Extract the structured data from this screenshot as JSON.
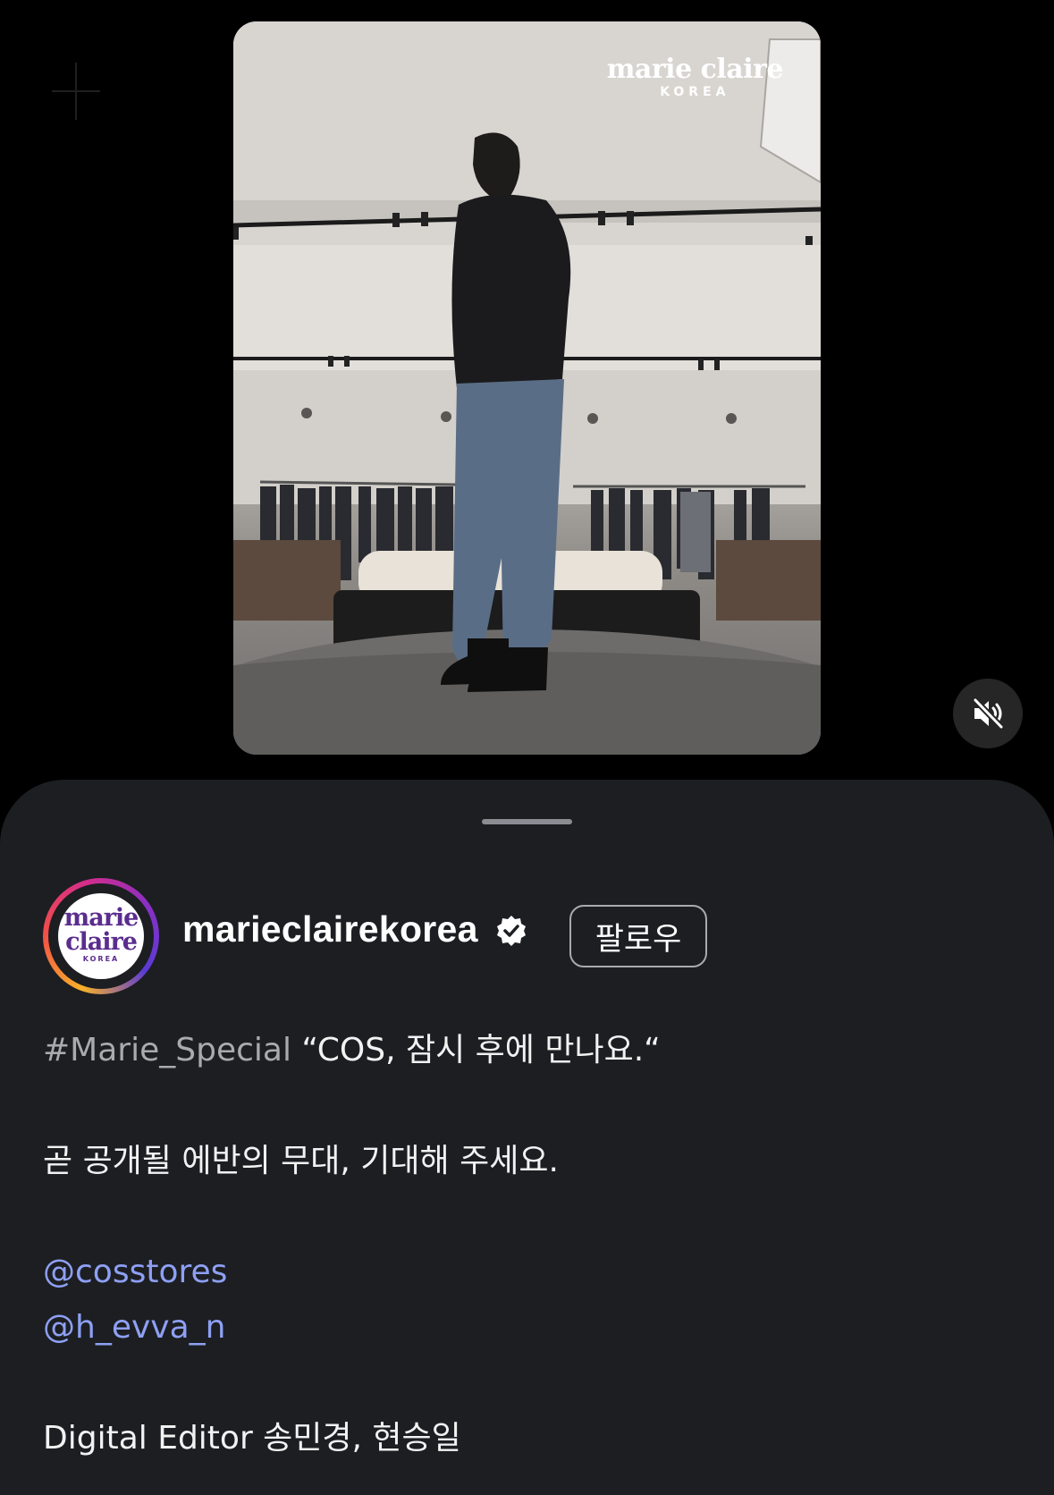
{
  "video": {
    "watermark_main": "marie claire",
    "watermark_sub": "KOREA",
    "mute_icon": "speaker-muted-icon"
  },
  "post": {
    "avatar": {
      "line1": "marie",
      "line2": "claire",
      "line3": "KOREA"
    },
    "username": "marieclairekorea",
    "verified_icon": "verified-badge-icon",
    "follow_label": "팔로우",
    "caption": {
      "hashtag": "#Marie_Special",
      "headline": "“COS, 잠시 후에 만나요.“",
      "line2": "곧 공개될 에반의 무대, 기대해 주세요.",
      "mentions": [
        "@cosstores",
        "@h_evva_n"
      ],
      "credit": "Digital Editor 송민경, 현승일"
    }
  },
  "colors": {
    "sheet_bg": "#1c1e22",
    "mention": "#8ea0f3",
    "hashtag": "#a8aaae"
  }
}
